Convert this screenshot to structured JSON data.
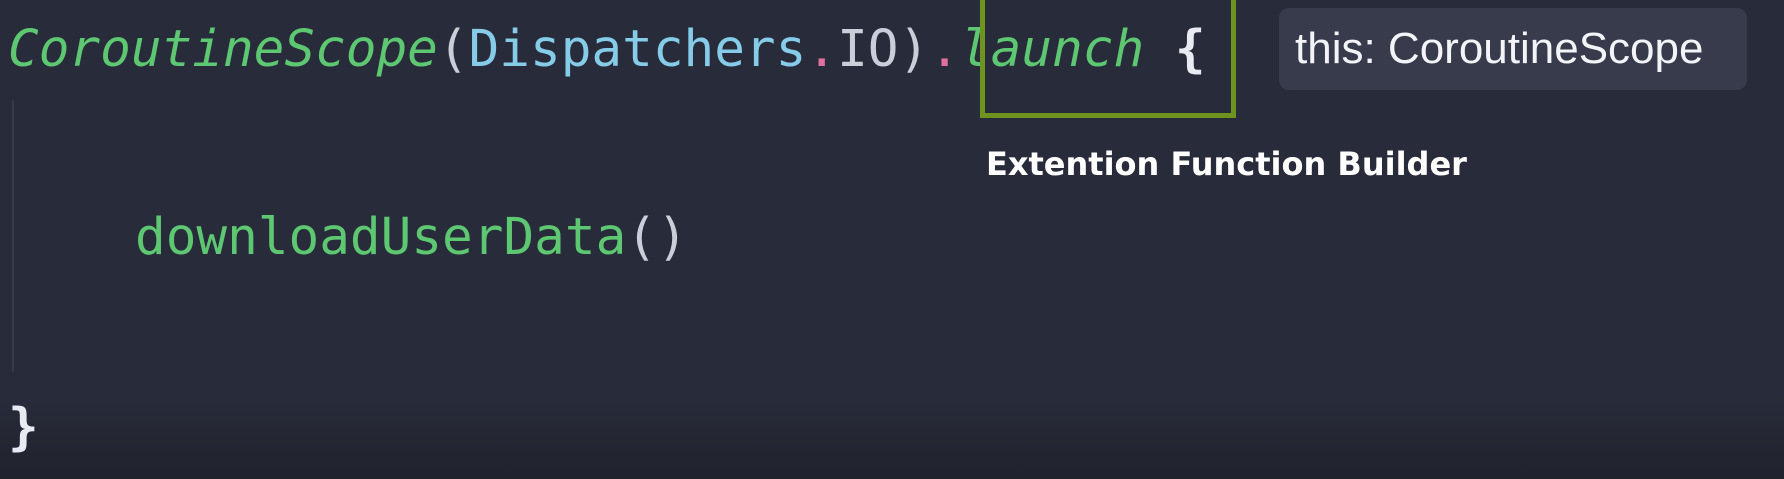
{
  "code": {
    "line1": {
      "scope_class": "CoroutineScope",
      "open_paren": "(",
      "dispatchers": "Dispatchers",
      "dot1": ".",
      "io": "IO",
      "close_paren": ")",
      "dot2": ".",
      "launch": "launch",
      "space": " ",
      "open_brace": "{"
    },
    "line2": {
      "function_name": "downloadUserData",
      "call_parens": "()"
    },
    "line3": {
      "close_brace": "}"
    }
  },
  "inlay_hint": {
    "text": "this: CoroutineScope"
  },
  "annotation": {
    "caption": "Extention Function Builder"
  },
  "colors": {
    "editor_background": "#282c3a",
    "function_green": "#5ec772",
    "type_blue": "#86cce8",
    "dot_pink": "#e0709c",
    "highlight_box_border": "#6f931f",
    "hint_background": "#373b4c"
  }
}
